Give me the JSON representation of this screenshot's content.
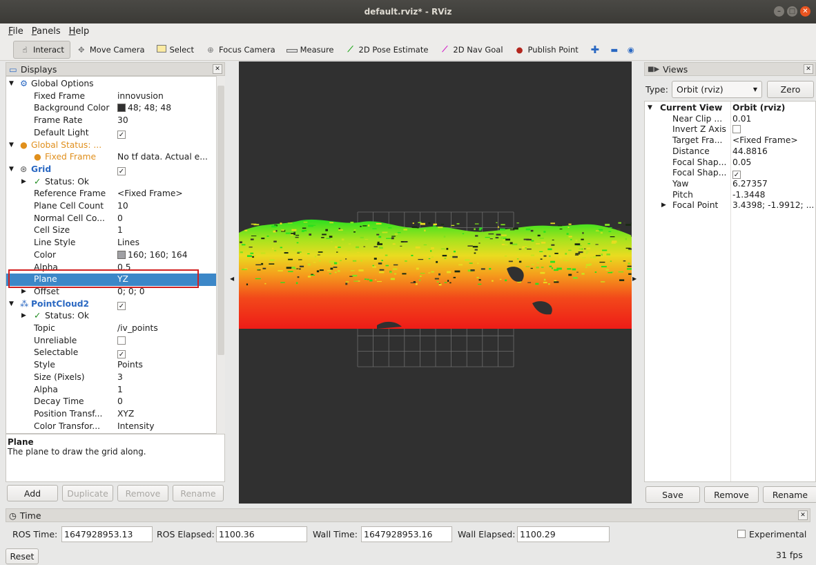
{
  "window": {
    "title": "default.rviz* - RViz"
  },
  "menu": [
    "File",
    "Panels",
    "Help"
  ],
  "toolbar": {
    "tools": [
      {
        "label": "Interact",
        "icon": "hand-icon",
        "active": true
      },
      {
        "label": "Move Camera",
        "icon": "move-camera-icon"
      },
      {
        "label": "Select",
        "icon": "select-icon"
      },
      {
        "label": "Focus Camera",
        "icon": "focus-camera-icon"
      },
      {
        "label": "Measure",
        "icon": "ruler-icon"
      },
      {
        "label": "2D Pose Estimate",
        "icon": "pose-estimate-icon",
        "color": "#22a81c"
      },
      {
        "label": "2D Nav Goal",
        "icon": "nav-goal-icon",
        "color": "#d21fc9"
      },
      {
        "label": "Publish Point",
        "icon": "map-pin-icon",
        "color": "#b3261e"
      }
    ]
  },
  "displays": {
    "title": "Displays",
    "rows": [
      {
        "key": "Global Options",
        "val": "",
        "indent": 1,
        "arrow": "open",
        "icon": "gear"
      },
      {
        "key": "Fixed Frame",
        "val": "innovusion",
        "indent": 2
      },
      {
        "key": "Background Color",
        "val": "48; 48; 48",
        "indent": 2,
        "swatch": "#303030"
      },
      {
        "key": "Frame Rate",
        "val": "30",
        "indent": 2
      },
      {
        "key": "Default Light",
        "val": "",
        "indent": 2,
        "check": true
      },
      {
        "key": "Global Status: ...",
        "val": "",
        "indent": 1,
        "arrow": "open",
        "icon": "warn",
        "cls": "orange"
      },
      {
        "key": "Fixed Frame",
        "val": "No tf data.  Actual e...",
        "indent": 2,
        "icon": "warn",
        "cls": "orange"
      },
      {
        "key": "Grid",
        "val": "",
        "indent": 1,
        "arrow": "open",
        "icon": "grid",
        "cls": "blue bold",
        "check": true
      },
      {
        "key": "Status: Ok",
        "val": "",
        "indent": 2,
        "arrow": "closed",
        "icon": "ok"
      },
      {
        "key": "Reference Frame",
        "val": "<Fixed Frame>",
        "indent": 2
      },
      {
        "key": "Plane Cell Count",
        "val": "10",
        "indent": 2
      },
      {
        "key": "Normal Cell Co...",
        "val": "0",
        "indent": 2
      },
      {
        "key": "Cell Size",
        "val": "1",
        "indent": 2
      },
      {
        "key": "Line Style",
        "val": "Lines",
        "indent": 2
      },
      {
        "key": "Color",
        "val": "160; 160; 164",
        "indent": 2,
        "swatch": "#a0a0a4"
      },
      {
        "key": "Alpha",
        "val": "0.5",
        "indent": 2
      },
      {
        "key": "Plane",
        "val": "YZ",
        "indent": 2,
        "selected": true
      },
      {
        "key": "Offset",
        "val": "0; 0; 0",
        "indent": 2,
        "arrow": "closed"
      },
      {
        "key": "PointCloud2",
        "val": "",
        "indent": 1,
        "arrow": "open",
        "icon": "cloud",
        "cls": "blue bold",
        "check": true
      },
      {
        "key": "Status: Ok",
        "val": "",
        "indent": 2,
        "arrow": "closed",
        "icon": "ok"
      },
      {
        "key": "Topic",
        "val": "/iv_points",
        "indent": 2
      },
      {
        "key": "Unreliable",
        "val": "",
        "indent": 2,
        "check": false
      },
      {
        "key": "Selectable",
        "val": "",
        "indent": 2,
        "check": true
      },
      {
        "key": "Style",
        "val": "Points",
        "indent": 2
      },
      {
        "key": "Size (Pixels)",
        "val": "3",
        "indent": 2
      },
      {
        "key": "Alpha",
        "val": "1",
        "indent": 2
      },
      {
        "key": "Decay Time",
        "val": "0",
        "indent": 2
      },
      {
        "key": "Position Transf...",
        "val": "XYZ",
        "indent": 2
      },
      {
        "key": "Color Transfor...",
        "val": "Intensity",
        "indent": 2
      }
    ],
    "desc_title": "Plane",
    "desc_text": "The plane to draw the grid along.",
    "buttons": [
      "Add",
      "Duplicate",
      "Remove",
      "Rename"
    ]
  },
  "views": {
    "title": "Views",
    "type_label": "Type:",
    "type_value": "Orbit (rviz)",
    "zero_label": "Zero",
    "rows": [
      {
        "key": "Current View",
        "val": "Orbit (rviz)",
        "bold": true,
        "arrow": "open"
      },
      {
        "key": "Near Clip ...",
        "val": "0.01"
      },
      {
        "key": "Invert Z Axis",
        "val": "",
        "check": false
      },
      {
        "key": "Target Fra...",
        "val": "<Fixed Frame>"
      },
      {
        "key": "Distance",
        "val": "44.8816"
      },
      {
        "key": "Focal Shap...",
        "val": "0.05"
      },
      {
        "key": "Focal Shap...",
        "val": "",
        "check": true
      },
      {
        "key": "Yaw",
        "val": "6.27357"
      },
      {
        "key": "Pitch",
        "val": "-1.3448"
      },
      {
        "key": "Focal Point",
        "val": "3.4398; -1.9912; ...",
        "arrow": "closed"
      }
    ],
    "buttons": [
      "Save",
      "Remove",
      "Rename"
    ]
  },
  "time": {
    "title": "Time",
    "ros_time_label": "ROS Time:",
    "ros_time": "1647928953.13",
    "ros_elapsed_label": "ROS Elapsed:",
    "ros_elapsed": "1100.36",
    "wall_time_label": "Wall Time:",
    "wall_time": "1647928953.16",
    "wall_elapsed_label": "Wall Elapsed:",
    "wall_elapsed": "1100.29",
    "experimental_label": "Experimental",
    "reset_label": "Reset",
    "fps": "31 fps"
  },
  "colors": {
    "selection": "#3c87c8",
    "highlight_box": "#d11f1f",
    "viewport_bg": "#303030"
  }
}
